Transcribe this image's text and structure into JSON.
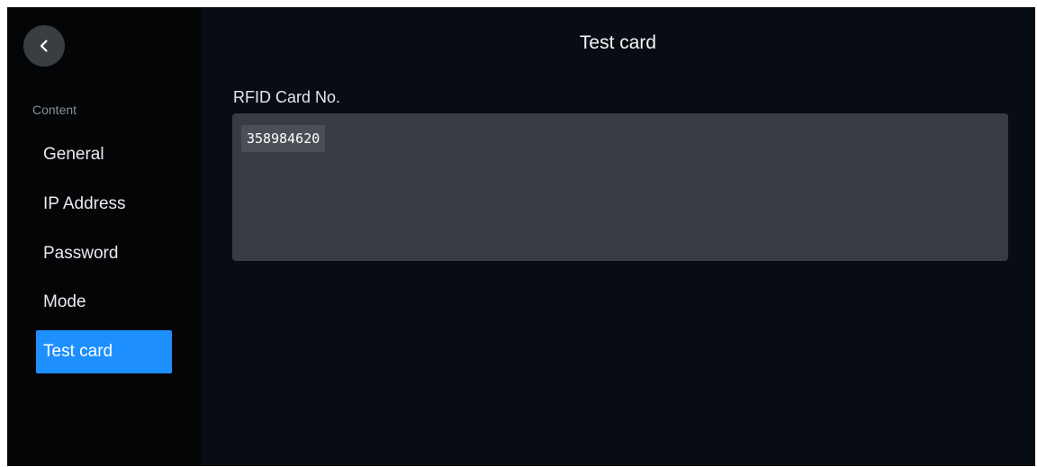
{
  "header": {
    "title": "Test card",
    "back_icon": "chevron-left-icon"
  },
  "sidebar": {
    "section_label": "Content",
    "items": [
      {
        "label": "General",
        "active": false
      },
      {
        "label": "IP Address",
        "active": false
      },
      {
        "label": "Password",
        "active": false
      },
      {
        "label": "Mode",
        "active": false
      },
      {
        "label": "Test card",
        "active": true
      }
    ]
  },
  "main": {
    "field_label": "RFID Card No.",
    "card_number": "358984620"
  },
  "colors": {
    "accent": "#1e8fff",
    "background": "#080c13",
    "sidebar_background": "#030507",
    "field_background": "#373b42"
  }
}
